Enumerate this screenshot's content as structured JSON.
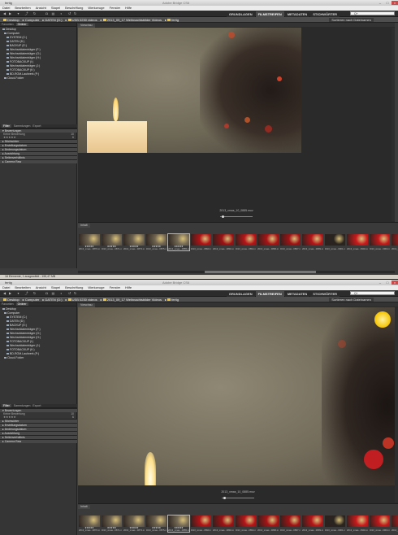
{
  "app": {
    "title": "fertig",
    "window_title": "Adobe Bridge CS6",
    "menu": [
      "Datei",
      "Bearbeiten",
      "Ansicht",
      "Stapel",
      "Beschriftung",
      "Werkzeuge",
      "Fenster",
      "Hilfe"
    ]
  },
  "toolbar": {
    "workspaces": [
      "GRUNDLAGEN",
      "FILMSTREIFEN",
      "METADATEN",
      "STICHWÖRTER"
    ],
    "active_workspace": "FILMSTREIFEN",
    "search_placeholder": "Q+",
    "sort_label": "Sortieren nach Dateinamen"
  },
  "breadcrumb": [
    "Desktop",
    "Computer",
    "DATEN (D:)",
    "USB 0230 videos",
    "2013_09_17 Weihnachtsbilder Videos",
    "fertig"
  ],
  "left_panel": {
    "tabs": [
      "Favoriten",
      "Ordner"
    ],
    "active_tab": "Ordner",
    "tree": [
      "Desktop",
      "Computer",
      "SYSTEM (C:)",
      "DATEN (D:)",
      "BACKUP (E:)",
      "Wechseldatenträger (F:)",
      "Wechseldatenträger (G:)",
      "Wechseldatenträger (H:)",
      "FOTOBACKUP (I:)",
      "Wechseldatenträger (J:)",
      "FOTOBACKUP (K:)",
      "BD-ROM-Laufwerk (P:)",
      "Cloud-Folder"
    ],
    "filter_tabs": [
      "Filter",
      "Sammlungen",
      "Export"
    ],
    "filter_sections": [
      "Bewertungen",
      "Stichwörter",
      "Erstellungsdatum",
      "Änderungsdatum",
      "Ausrichtung",
      "Seitenverhältnis",
      "Camera Raw"
    ],
    "rating_rows": [
      {
        "label": "Keine Bewertung",
        "count": "10"
      },
      {
        "label": "★★★★★",
        "count": "6"
      }
    ]
  },
  "preview": {
    "tab": "Vorschau",
    "filename": "2013_xmas_10_0885.mov"
  },
  "filmstrip": {
    "tab": "Inhalt",
    "thumbnails": [
      {
        "label": "2013_xmas...0870.mov",
        "stars": "★★★★★"
      },
      {
        "label": "2013_xmas...0871.mov",
        "stars": "★★★★★"
      },
      {
        "label": "2013_xmas...0873.mov",
        "stars": "★★★★★"
      },
      {
        "label": "2013_xmas...0875.mov",
        "stars": "★★★★★"
      },
      {
        "label": "2013_xmas...0885.mov",
        "stars": "★★★★★"
      },
      {
        "label": "2013_xmas...0890.mov",
        "stars": ""
      },
      {
        "label": "2013_xmas...0892.mov",
        "stars": ""
      },
      {
        "label": "2013_xmas...0894.mov",
        "stars": ""
      },
      {
        "label": "2013_xmas...0896.mov",
        "stars": ""
      },
      {
        "label": "2013_xmas...0897.mov",
        "stars": ""
      },
      {
        "label": "2013_xmas...0899.mov",
        "stars": ""
      },
      {
        "label": "2013_xmas...0901.mov",
        "stars": ""
      },
      {
        "label": "2013_xmas...0902.mov",
        "stars": ""
      },
      {
        "label": "2013_xmas...0904.mov",
        "stars": ""
      },
      {
        "label": "2013_xmas...0906.mov",
        "stars": ""
      }
    ]
  },
  "status": {
    "text": "16 Elemente, 1 ausgewählt - 195,47 MB"
  },
  "colors": {
    "accent": "#e8c34a",
    "candle": "#f3d9a8",
    "background_dark": "#2a2a2a"
  }
}
